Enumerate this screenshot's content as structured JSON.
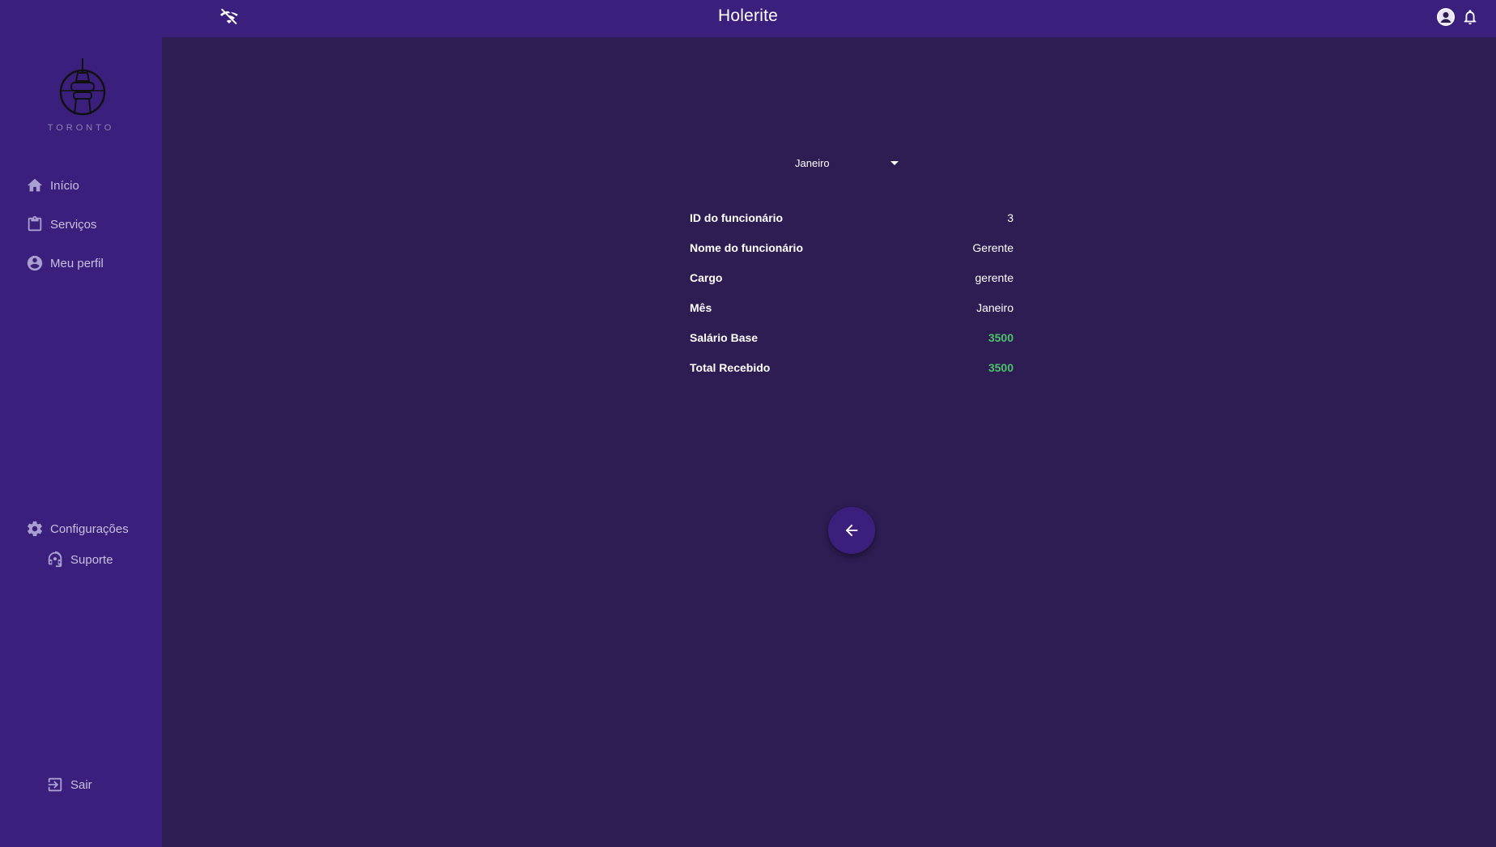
{
  "header": {
    "title": "Holerite",
    "icons": {
      "status": "wifi-off-icon",
      "profile": "account-avatar-icon",
      "notifications": "bell-icon"
    }
  },
  "sidebar": {
    "logo_text": "TORONTO",
    "items": [
      {
        "label": "Início",
        "icon": "home-icon"
      },
      {
        "label": "Serviços",
        "icon": "clipboard-icon"
      },
      {
        "label": "Meu perfil",
        "icon": "account-circle-icon"
      }
    ],
    "bottom_items": [
      {
        "label": "Configurações",
        "icon": "gear-icon"
      },
      {
        "label": "Suporte",
        "icon": "headset-icon"
      }
    ],
    "logout": {
      "label": "Sair",
      "icon": "logout-icon"
    }
  },
  "main": {
    "month_select": {
      "value": "Janeiro"
    },
    "rows": [
      {
        "label": "ID do funcionário",
        "value": "3"
      },
      {
        "label": "Nome do funcionário",
        "value": "Gerente"
      },
      {
        "label": "Cargo",
        "value": "gerente"
      },
      {
        "label": "Mês",
        "value": "Janeiro"
      },
      {
        "label": "Salário Base",
        "value": "3500"
      },
      {
        "label": "Total Recebido",
        "value": "3500"
      }
    ],
    "back_button": {
      "icon": "arrow-left-icon"
    }
  },
  "colors": {
    "sidebar_bg": "#3b1f7c",
    "content_bg": "#2e1d53",
    "money_green": "#4cc36a"
  }
}
